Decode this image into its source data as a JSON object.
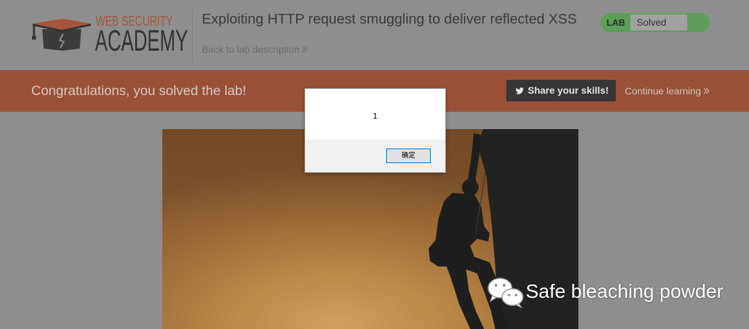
{
  "header": {
    "logo": {
      "icon": "graduation-cap-icon",
      "line1": "WEB SECURITY",
      "line2": "ACADEMY"
    },
    "title": "Exploiting HTTP request smuggling to deliver reflected XSS",
    "back_link": {
      "label": "Back to lab description",
      "icon": "double-chevron-right-icon"
    },
    "lab_status": {
      "label": "LAB",
      "value": "Solved"
    }
  },
  "banner": {
    "message": "Congratulations, you solved the lab!",
    "share_button": {
      "icon": "twitter-icon",
      "label": "Share your skills!"
    },
    "continue_link": {
      "label": "Continue learning",
      "icon": "double-chevron-right-icon"
    }
  },
  "dialog": {
    "message": "1",
    "ok_button": "确定"
  },
  "watermark": {
    "icon": "wechat-icon",
    "text": "Safe bleaching powder"
  },
  "colors": {
    "page_bg": "#8e8e8e",
    "logo_accent": "#a4553b",
    "status_green": "#5d9e58",
    "banner_bg": "#9a5037",
    "share_button_bg": "#363636",
    "dialog_button_border": "#0078d7"
  }
}
